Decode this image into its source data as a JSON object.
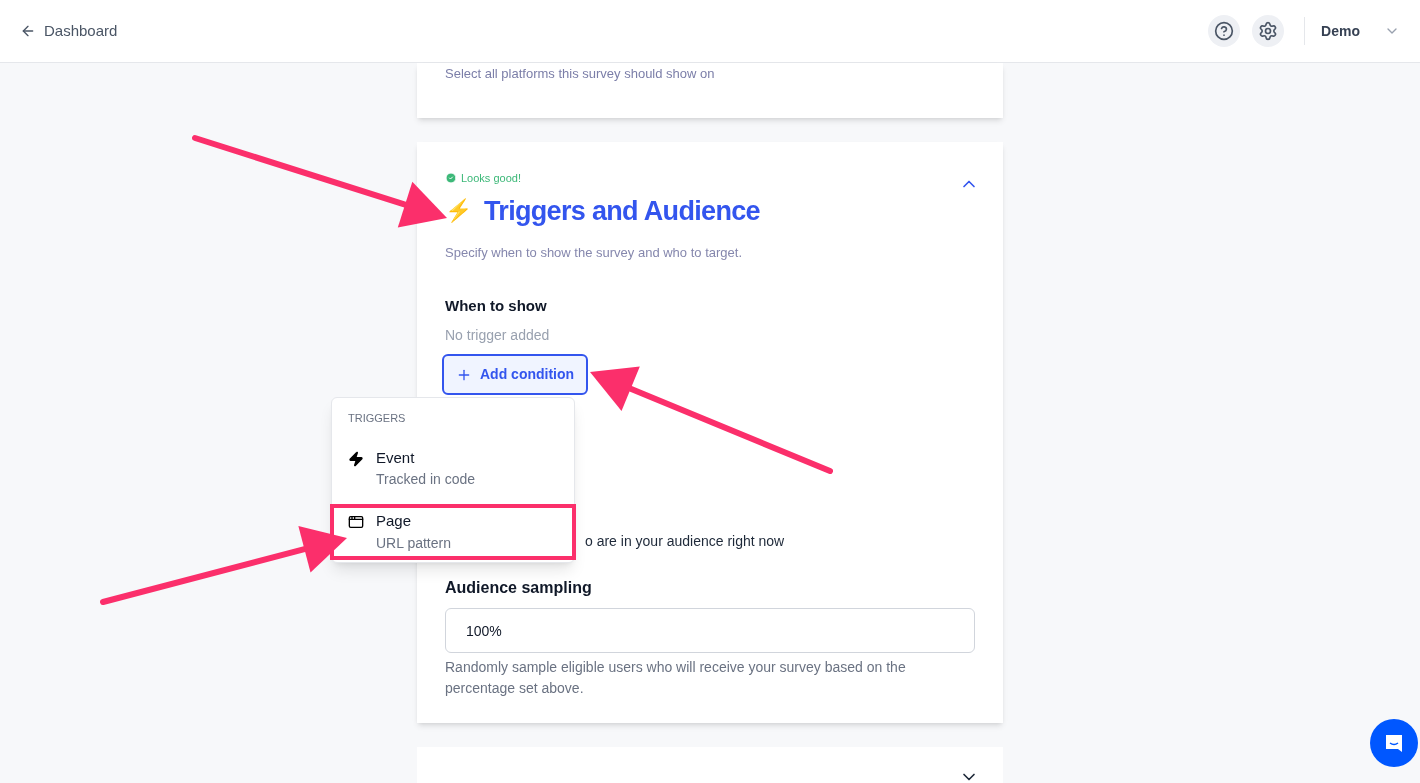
{
  "header": {
    "back_label": "Dashboard",
    "user": "Demo"
  },
  "platforms_card": {
    "hint": "Select all platforms this survey should show on"
  },
  "triggers_card": {
    "status": "Looks good!",
    "icon": "⚡",
    "title": "Triggers and Audience",
    "subtitle": "Specify when to show the survey and who to target.",
    "expanded": true,
    "when_to_show": {
      "heading": "When to show",
      "empty_text": "No trigger added",
      "add_button": "Add condition"
    },
    "audience_text": "o are in your audience right now",
    "sampling": {
      "heading": "Audience sampling",
      "value": "100%",
      "help": "Randomly sample eligible users who will receive your survey based on the percentage set above."
    }
  },
  "next_card": {
    "expanded": false
  },
  "trigger_menu": {
    "heading": "TRIGGERS",
    "items": [
      {
        "kind": "event",
        "label": "Event",
        "description": "Tracked in code",
        "highlighted": false
      },
      {
        "kind": "page",
        "label": "Page",
        "description": "URL pattern",
        "highlighted": true
      }
    ]
  }
}
